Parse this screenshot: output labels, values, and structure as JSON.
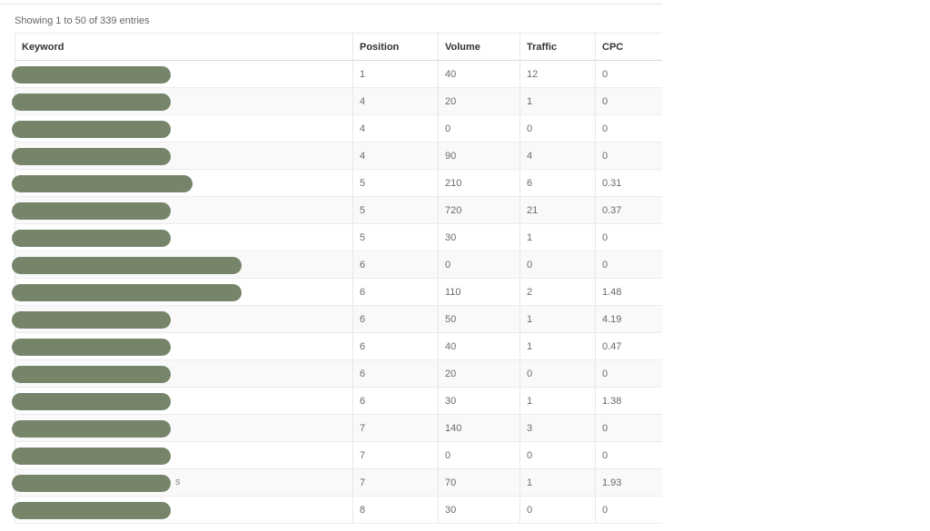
{
  "table_info": "Showing 1 to 50 of 339 entries",
  "columns": [
    "Keyword",
    "Position",
    "Volume",
    "Traffic",
    "CPC"
  ],
  "rows": [
    {
      "keyword": "",
      "position": "1",
      "volume": "40",
      "traffic": "12",
      "cpc": "0"
    },
    {
      "keyword": "",
      "position": "4",
      "volume": "20",
      "traffic": "1",
      "cpc": "0"
    },
    {
      "keyword": "",
      "position": "4",
      "volume": "0",
      "traffic": "0",
      "cpc": "0"
    },
    {
      "keyword": "",
      "position": "4",
      "volume": "90",
      "traffic": "4",
      "cpc": "0"
    },
    {
      "keyword": "",
      "position": "5",
      "volume": "210",
      "traffic": "6",
      "cpc": "0.31"
    },
    {
      "keyword": "",
      "position": "5",
      "volume": "720",
      "traffic": "21",
      "cpc": "0.37"
    },
    {
      "keyword": "",
      "position": "5",
      "volume": "30",
      "traffic": "1",
      "cpc": "0"
    },
    {
      "keyword": "",
      "position": "6",
      "volume": "0",
      "traffic": "0",
      "cpc": "0"
    },
    {
      "keyword": "",
      "position": "6",
      "volume": "110",
      "traffic": "2",
      "cpc": "1.48"
    },
    {
      "keyword": "",
      "position": "6",
      "volume": "50",
      "traffic": "1",
      "cpc": "4.19"
    },
    {
      "keyword": "",
      "position": "6",
      "volume": "40",
      "traffic": "1",
      "cpc": "0.47"
    },
    {
      "keyword": "",
      "position": "6",
      "volume": "20",
      "traffic": "0",
      "cpc": "0"
    },
    {
      "keyword": "",
      "position": "6",
      "volume": "30",
      "traffic": "1",
      "cpc": "1.38"
    },
    {
      "keyword": "",
      "position": "7",
      "volume": "140",
      "traffic": "3",
      "cpc": "0"
    },
    {
      "keyword": "",
      "position": "7",
      "volume": "0",
      "traffic": "0",
      "cpc": "0"
    },
    {
      "keyword": "s",
      "position": "7",
      "volume": "70",
      "traffic": "1",
      "cpc": "1.93"
    },
    {
      "keyword": "",
      "position": "8",
      "volume": "30",
      "traffic": "0",
      "cpc": "0"
    }
  ],
  "colors": {
    "redaction": "#76856a",
    "stripe": "#f9f9f9",
    "border": "#e8e8e8"
  }
}
